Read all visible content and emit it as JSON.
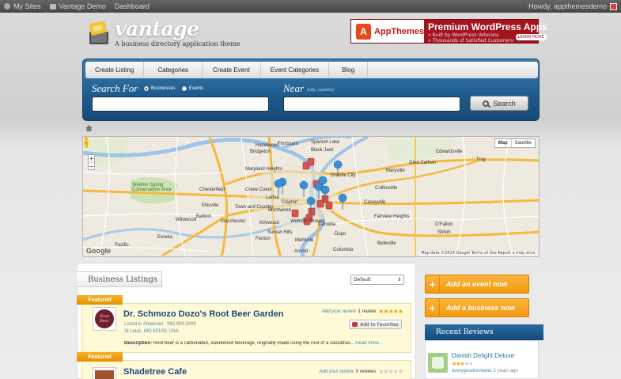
{
  "adminbar": {
    "my_sites": "My Sites",
    "site_name": "Vantage Demo",
    "dashboard": "Dashboard",
    "howdy": "Howdy, appthemesdemo"
  },
  "header": {
    "logo_text": "vantage",
    "tagline": "A business directory application theme",
    "ad": {
      "brand": "AppThemes",
      "title": "Premium WordPress Apps",
      "line1": "» Built by WordPress Veterans",
      "line2": "» Thousands of Satisfied Customers",
      "button": "LEARN MORE"
    }
  },
  "nav": {
    "items": [
      "Create Listing",
      "Categories",
      "Create Event",
      "Event Categories",
      "Blog"
    ]
  },
  "search": {
    "search_for_label": "Search For",
    "option_businesses": "Businesses",
    "option_events": "Events",
    "near_label": "Near",
    "near_hint": "(city, country)",
    "query_value": "",
    "near_value": "",
    "button_label": "Search"
  },
  "map": {
    "type_map": "Map",
    "type_satellite": "Satellite",
    "zoom_in": "+",
    "zoom_out": "−",
    "attribution": "Map data ©2014 Google  Terms of Use  Report a map error",
    "google": "Google",
    "labels": [
      "Florissant",
      "Spanish Lake",
      "Hazelwood",
      "Bridgeton",
      "Black Jack",
      "Granite City",
      "Maryland Heights",
      "Creve Coeur",
      "Chesterfield",
      "Clayton",
      "Town and Country",
      "Ladue",
      "Brentwood",
      "Manchester",
      "Ballwin",
      "Wildwood",
      "Kirkwood",
      "Sunset Hills",
      "Webster Groves",
      "Fenton",
      "Arnold",
      "Mehlville",
      "Cahokia",
      "Collinsville",
      "Caseyville",
      "Fairview Heights",
      "Belleville",
      "Dupo",
      "Columbia",
      "Ellisville",
      "Pacific",
      "Eureka",
      "Weldon Spring Conservation Area",
      "Glen Carbon",
      "Edwardsville",
      "O'Fallon",
      "Shiloh",
      "Maryville",
      "Troy"
    ]
  },
  "listings": {
    "section_title": "Business Listings",
    "sort_value": "Default",
    "items": [
      {
        "ribbon": "Featured",
        "title": "Dr. Schmozo Dozo's Root Beer Garden",
        "thumb_text": "Root Beer",
        "listed_in_label": "Listed in",
        "category": "American",
        "phone": "999.999.9999",
        "address": "St Louis, MO 63103, USA",
        "add_review": "Add your review",
        "review_count": "1 review",
        "rating": 5,
        "favorite": "Add to Favorites",
        "desc_label": "Description:",
        "description": "Root beer is a carbonated, sweetened beverage, originally made using the root of a sassafras...",
        "read_more": "Read more..."
      },
      {
        "ribbon": "Featured",
        "title": "Shadetree Cafe",
        "add_review": "Add your review",
        "review_count": "0 reviews",
        "rating": 0
      }
    ]
  },
  "sidebar": {
    "add_event": "Add an event now",
    "add_business": "Add a business now",
    "recent_reviews_title": "Recent Reviews",
    "review": {
      "title": "Danish Delight Deluxe",
      "rating": 3,
      "user": "averygoodreviewer",
      "ago": "2 years ago"
    }
  },
  "colors": {
    "panel_blue": "#1e5a8c",
    "featured_orange": "#f39a10",
    "link_blue": "#1c4a7a",
    "listing_bg": "#fef9d7"
  }
}
